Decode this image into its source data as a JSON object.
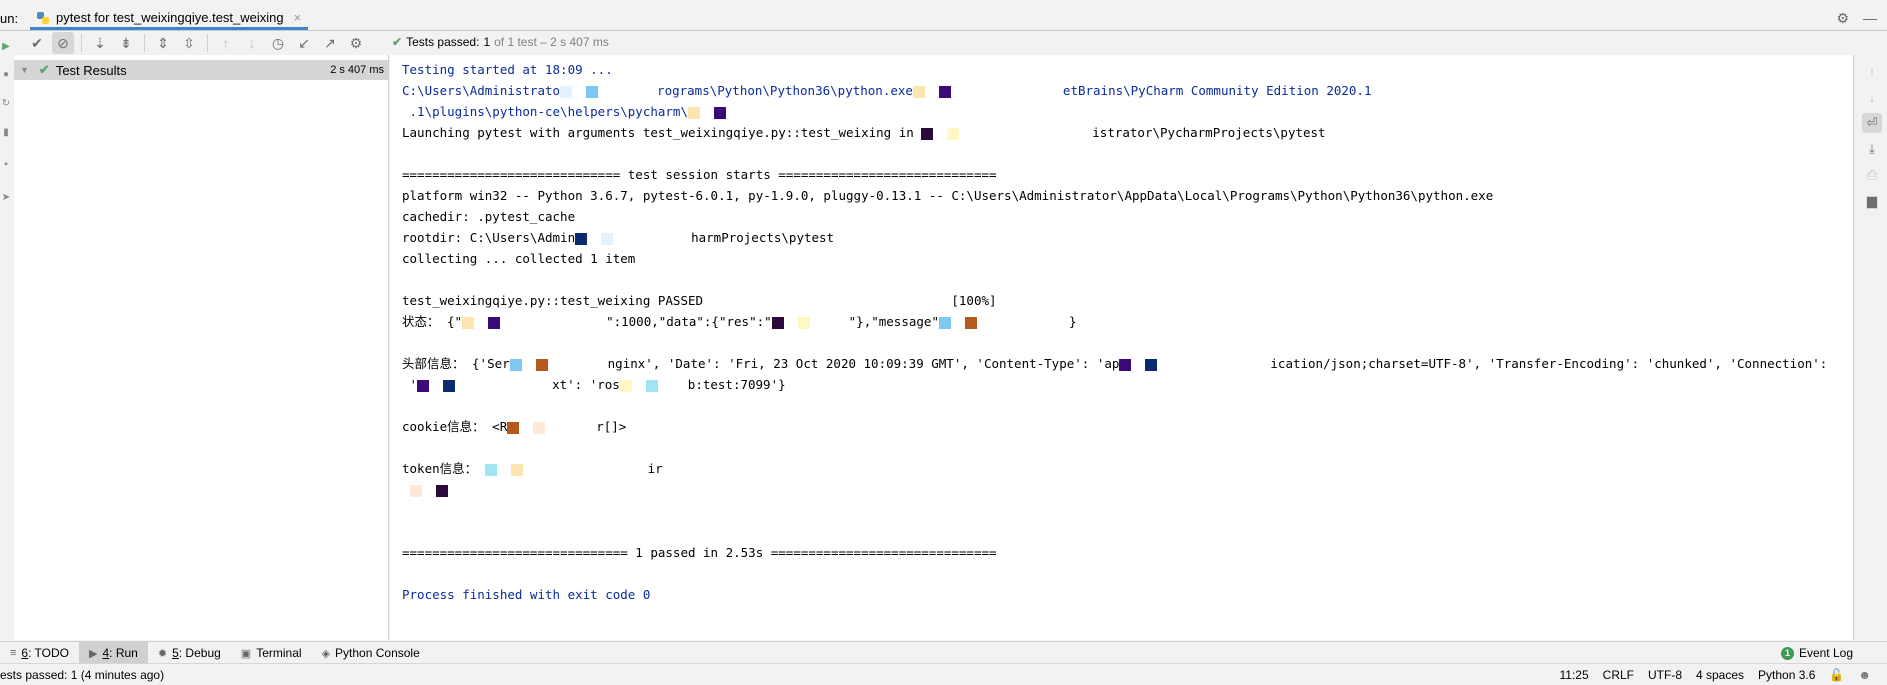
{
  "run_bar": {
    "label": "un:",
    "tab_title": "pytest for test_weixingqiye.test_weixing",
    "tab_close": "×"
  },
  "toolbar": {
    "buttons": [
      {
        "name": "show-passed",
        "icon": "✔"
      },
      {
        "name": "show-ignored",
        "icon": "⊘"
      },
      {
        "name": "sort-alphabetically",
        "icon": "↓a"
      },
      {
        "name": "sort-by-duration",
        "icon": "↓≡"
      },
      {
        "name": "expand-all",
        "icon": "⇕"
      },
      {
        "name": "collapse-all",
        "icon": "⇳"
      },
      {
        "name": "previous-failed",
        "icon": "↑"
      },
      {
        "name": "next-failed",
        "icon": "↓"
      },
      {
        "name": "test-history",
        "icon": "◷"
      },
      {
        "name": "import-tests",
        "icon": "↙"
      },
      {
        "name": "export-tests",
        "icon": "↗"
      },
      {
        "name": "settings",
        "icon": "⚙"
      }
    ]
  },
  "summary": {
    "prefix": "Tests passed:",
    "count": "1",
    "rest": "of 1 test – 2 s 407 ms"
  },
  "tree": {
    "root_label": "Test Results",
    "root_duration": "2 s 407 ms"
  },
  "console": {
    "lines": [
      {
        "text": "Testing started at 18:09 ...",
        "style": "blue"
      },
      {
        "text": "C:\\Users\\Administrato[redacted]rograms\\Python\\Python36\\python.exe[redacted]etBrains\\PyCharm Community Edition 2020.1",
        "style": "blue"
      },
      {
        "text": " .1\\plugins\\python-ce\\helpers\\pycharm\\[redacted]",
        "style": "blue"
      },
      {
        "text": "Launching pytest with arguments test_weixingqiye.py::test_weixing in [redacted]istrator\\PycharmProjects\\pytest",
        "style": "normal"
      },
      {
        "text": "",
        "style": "normal"
      },
      {
        "text": "============================= test session starts =============================",
        "style": "normal"
      },
      {
        "text": "platform win32 -- Python 3.6.7, pytest-6.0.1, py-1.9.0, pluggy-0.13.1 -- C:\\Users\\Administrator\\AppData\\Local\\Programs\\Python\\Python36\\python.exe",
        "style": "normal"
      },
      {
        "text": "cachedir: .pytest_cache",
        "style": "normal"
      },
      {
        "text": "rootdir: C:\\Users\\Admin[redacted]harmProjects\\pytest",
        "style": "normal"
      },
      {
        "text": "collecting ... collected 1 item",
        "style": "normal"
      },
      {
        "text": "",
        "style": "normal"
      },
      {
        "text": "test_weixingqiye.py::test_weixing PASSED                                 [100%]",
        "style": "normal"
      },
      {
        "text": "状态： {\"[redacted]\":1000,\"data\":{\"res\":\"[redacted]\"},\"message\"[redacted]}",
        "style": "normal"
      },
      {
        "text": "",
        "style": "normal"
      },
      {
        "text": "头部信息： {'Ser[redacted]nginx', 'Date': 'Fri, 23 Oct 2020 10:09:39 GMT', 'Content-Type': 'ap[redacted]ication/json;charset=UTF-8', 'Transfer-Encoding': 'chunked', 'Connection':",
        "style": "normal"
      },
      {
        "text": " '[redacted]xt': 'ros[redacted]b:test:7099'}",
        "style": "normal"
      },
      {
        "text": "",
        "style": "normal"
      },
      {
        "text": "cookie信息： <R[redacted]r[]>",
        "style": "normal"
      },
      {
        "text": "",
        "style": "normal"
      },
      {
        "text": "token信息： [redacted]ir",
        "style": "normal"
      },
      {
        "text": " [redacted]",
        "style": "normal"
      },
      {
        "text": "",
        "style": "normal"
      },
      {
        "text": "",
        "style": "normal"
      },
      {
        "text": "============================== 1 passed in 2.53s ==============================",
        "style": "normal"
      },
      {
        "text": "",
        "style": "normal"
      },
      {
        "text": "Process finished with exit code 0",
        "style": "blue"
      }
    ]
  },
  "right_toolbar": {
    "buttons": [
      {
        "name": "up-stack",
        "icon": "↑",
        "state": "disabled"
      },
      {
        "name": "down-stack",
        "icon": "↓",
        "state": "disabled"
      },
      {
        "name": "soft-wrap",
        "icon": "⏎",
        "state": "active"
      },
      {
        "name": "scroll-to-end",
        "icon": "⤓",
        "state": "normal"
      },
      {
        "name": "print",
        "icon": "⎙",
        "state": "disabled"
      },
      {
        "name": "clear-all",
        "icon": "🗑",
        "state": "normal"
      }
    ]
  },
  "bottom_tabs": [
    {
      "key": "6",
      "label": ": TODO",
      "icon": "≡",
      "active": false
    },
    {
      "key": "4",
      "label": ": Run",
      "icon": "▶",
      "active": true
    },
    {
      "key": "5",
      "label": ": Debug",
      "icon": "✹",
      "active": false
    },
    {
      "key": "",
      "label": "Terminal",
      "icon": "▣",
      "active": false
    },
    {
      "key": "",
      "label": "Python Console",
      "icon": "◈",
      "active": false
    }
  ],
  "event_log": {
    "count": "1",
    "label": "Event Log"
  },
  "status_bar": {
    "message": "ests passed: 1 (4 minutes ago)",
    "position": "11:25",
    "line_sep": "CRLF",
    "encoding": "UTF-8",
    "indent": "4 spaces",
    "interpreter": "Python 3.6"
  },
  "colors": {
    "accent": "#4083c9",
    "pass_green": "#59a869",
    "console_blue": "#0a2b9a"
  }
}
